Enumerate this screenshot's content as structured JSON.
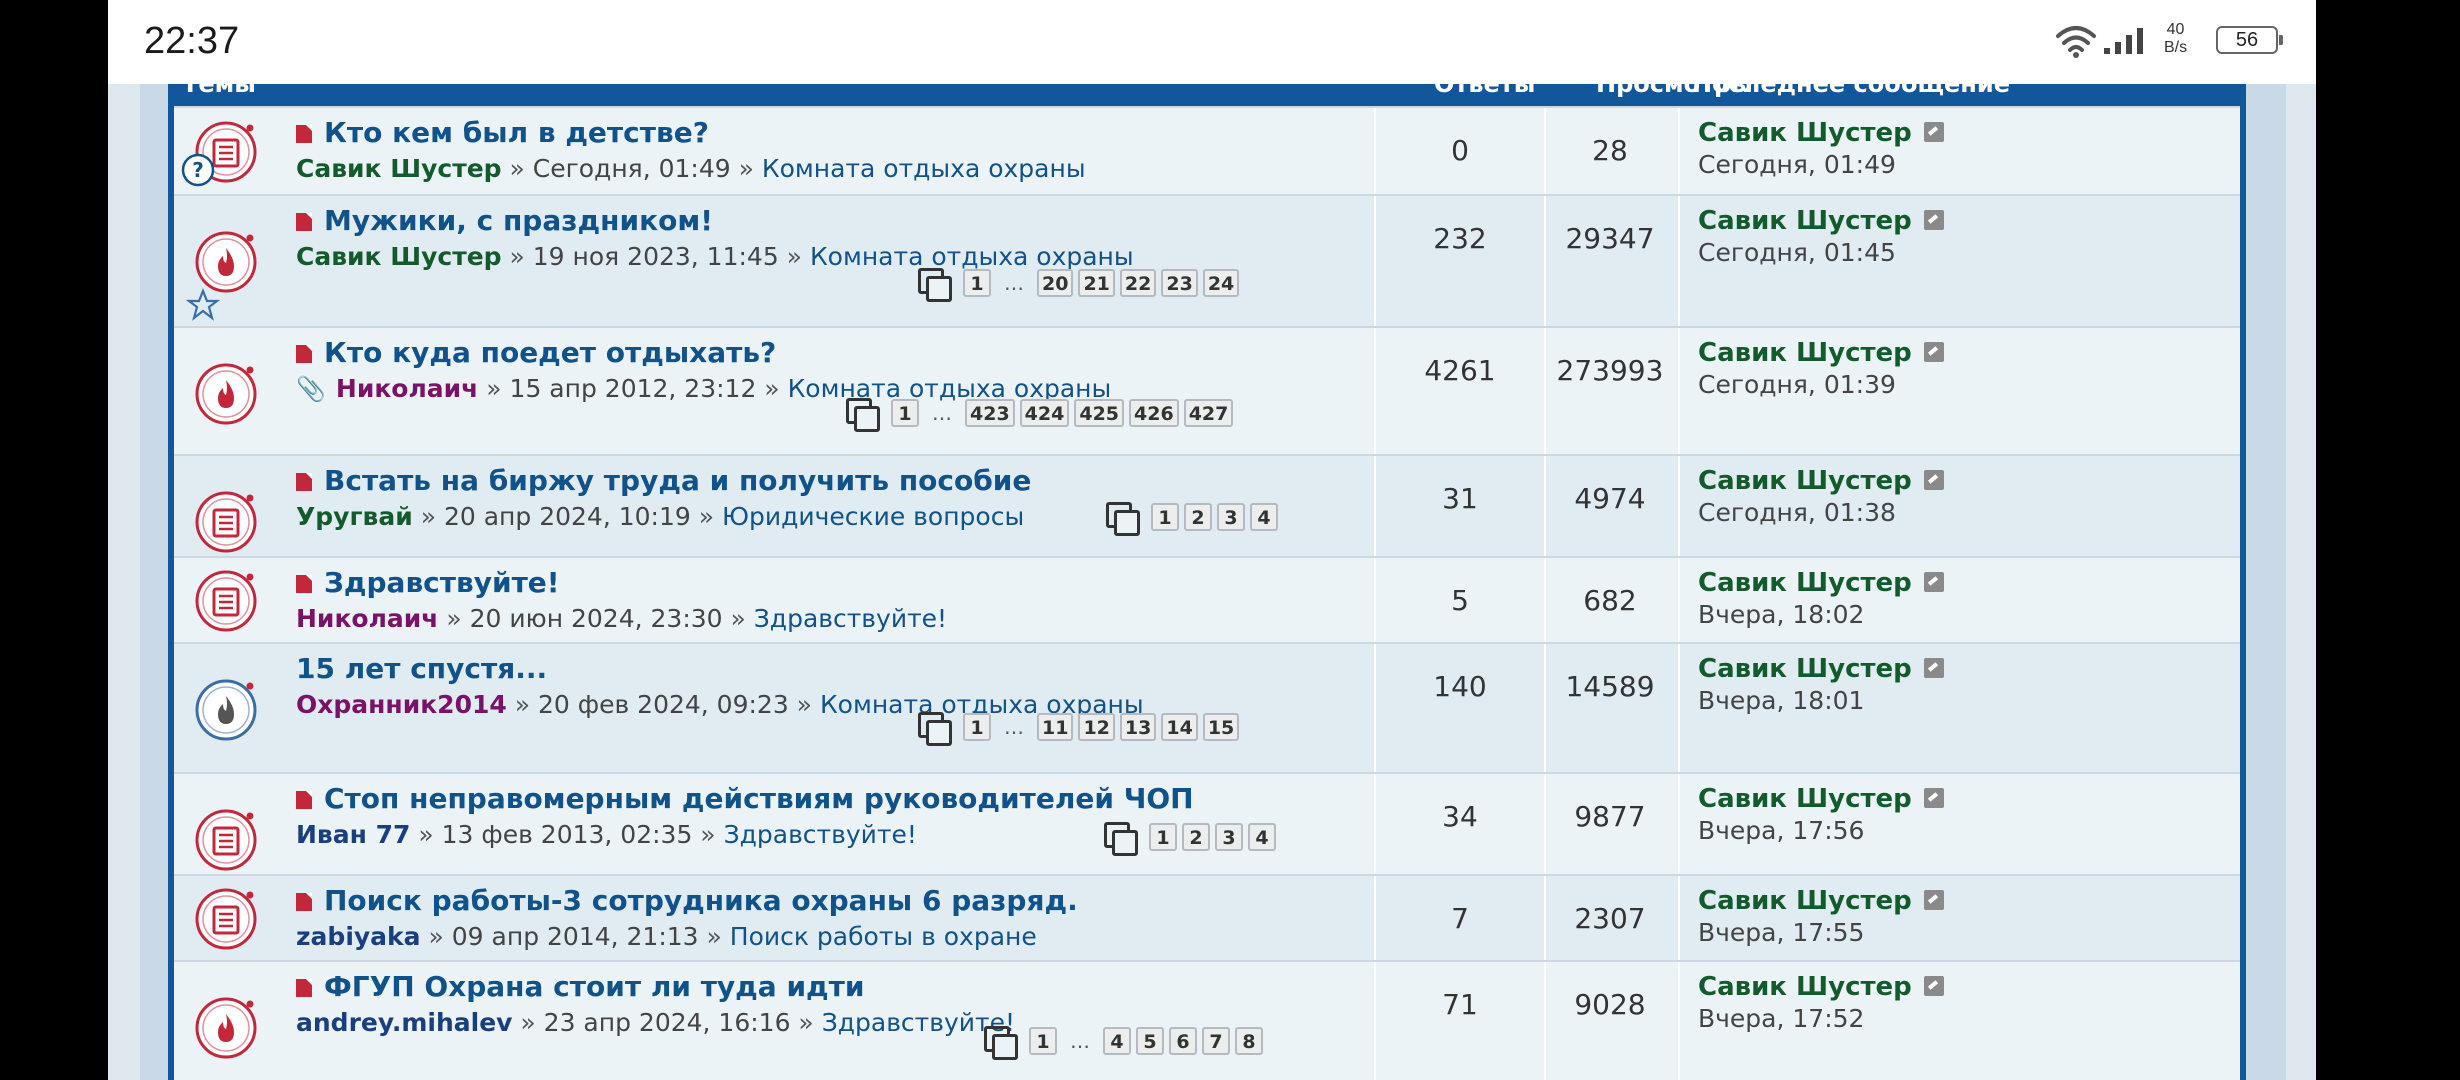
{
  "status_bar": {
    "time": "22:37",
    "net_speed_value": "40",
    "net_speed_unit": "B/s",
    "battery": "56"
  },
  "columns": {
    "topics": "Темы",
    "replies": "Ответы",
    "views": "Просмотры",
    "last_post": "Последнее сообщение"
  },
  "topics": [
    {
      "title": "Кто кем был в детстве?",
      "author": "Савик Шустер",
      "author_color": "green",
      "date": "Сегодня, 01:49",
      "forum": "Комната отдыха охраны",
      "replies": "0",
      "views": "28",
      "last_author": "Савик Шустер",
      "last_time": "Сегодня, 01:49",
      "icon": "unread-topic-icon",
      "sticky": true,
      "pages": []
    },
    {
      "title": "Мужики, с праздником!",
      "author": "Савик Шустер",
      "author_color": "green",
      "date": "19 ноя 2023, 11:45",
      "forum": "Комната отдыха охраны",
      "replies": "232",
      "views": "29347",
      "last_author": "Савик Шустер",
      "last_time": "Сегодня, 01:45",
      "icon": "hot-topic-icon",
      "sticky": true,
      "pages": [
        "1",
        "…",
        "20",
        "21",
        "22",
        "23",
        "24"
      ]
    },
    {
      "title": "Кто куда поедет отдыхать?",
      "author": "Николаич",
      "author_color": "purple",
      "date": "15 апр 2012, 23:12",
      "forum": "Комната отдыха охраны",
      "replies": "4261",
      "views": "273993",
      "last_author": "Савик Шустер",
      "last_time": "Сегодня, 01:39",
      "icon": "hot-topic-icon",
      "sticky": true,
      "attachment": true,
      "pages": [
        "1",
        "…",
        "423",
        "424",
        "425",
        "426",
        "427"
      ]
    },
    {
      "title": "Встать на биржу труда и получить пособие",
      "author": "Уругвай",
      "author_color": "green",
      "date": "20 апр 2024, 10:19",
      "forum": "Юридические вопросы",
      "replies": "31",
      "views": "4974",
      "last_author": "Савик Шустер",
      "last_time": "Сегодня, 01:38",
      "icon": "unread-topic-icon",
      "sticky": true,
      "pages": [
        "1",
        "2",
        "3",
        "4"
      ]
    },
    {
      "title": "Здравствуйте!",
      "author": "Николаич",
      "author_color": "purple",
      "date": "20 июн 2024, 23:30",
      "forum": "Здравствуйте!",
      "replies": "5",
      "views": "682",
      "last_author": "Савик Шустер",
      "last_time": "Вчера, 18:02",
      "icon": "unread-topic-icon",
      "sticky": true,
      "pages": []
    },
    {
      "title": "15 лет спустя...",
      "author": "Охранник2014",
      "author_color": "purple",
      "date": "20 фев 2024, 09:23",
      "forum": "Комната отдыха охраны",
      "replies": "140",
      "views": "14589",
      "last_author": "Савик Шустер",
      "last_time": "Вчера, 18:01",
      "icon": "hot-read-topic-icon",
      "sticky": false,
      "pages": [
        "1",
        "…",
        "11",
        "12",
        "13",
        "14",
        "15"
      ]
    },
    {
      "title": "Стоп неправомерным действиям руководителей ЧОП",
      "author": "Иван 77",
      "author_color": "blue",
      "date": "13 фев 2013, 02:35",
      "forum": "Здравствуйте!",
      "replies": "34",
      "views": "9877",
      "last_author": "Савик Шустер",
      "last_time": "Вчера, 17:56",
      "icon": "unread-topic-icon",
      "sticky": true,
      "pages": [
        "1",
        "2",
        "3",
        "4"
      ]
    },
    {
      "title": "Поиск работы-3 сотрудника охраны 6 разряд.",
      "author": "zabiyaka",
      "author_color": "blue",
      "date": "09 апр 2014, 21:13",
      "forum": "Поиск работы в охране",
      "replies": "7",
      "views": "2307",
      "last_author": "Савик Шустер",
      "last_time": "Вчера, 17:55",
      "icon": "unread-topic-icon",
      "sticky": true,
      "pages": []
    },
    {
      "title": "ФГУП Охрана стоит ли туда идти",
      "author": "andrey.mihalev",
      "author_color": "blue",
      "date": "23 апр 2024, 16:16",
      "forum": "Здравствуйте!",
      "replies": "71",
      "views": "9028",
      "last_author": "Савик Шустер",
      "last_time": "Вчера, 17:52",
      "icon": "hot-topic-icon",
      "sticky": true,
      "pages": [
        "1",
        "…",
        "4",
        "5",
        "6",
        "7",
        "8"
      ]
    }
  ],
  "nav_buttons": [
    "back-nav-icon",
    "home-nav-icon",
    "recents-nav-icon"
  ],
  "colors": {
    "header": "#12579a",
    "topic_link": "#105289",
    "username_green": "#135b2d",
    "username_purple": "#7a1268",
    "sticky_red": "#c3283a"
  }
}
